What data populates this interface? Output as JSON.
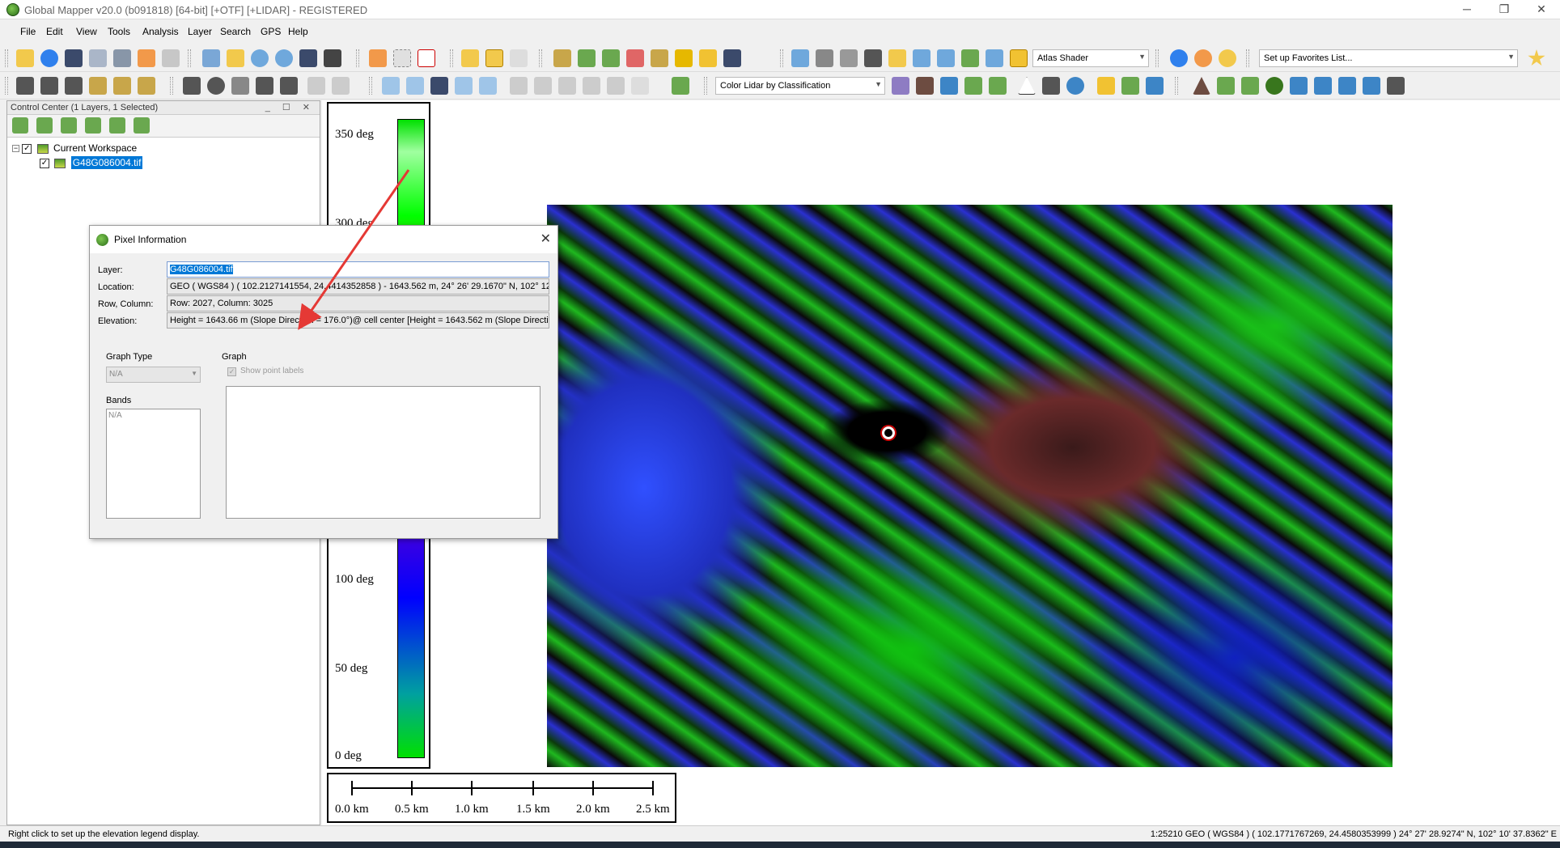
{
  "window": {
    "title": "Global Mapper v20.0 (b091818) [64-bit] [+OTF] [+LIDAR] - REGISTERED",
    "minimize": "─",
    "restore": "❐",
    "close": "✕"
  },
  "menu": [
    "File",
    "Edit",
    "View",
    "Tools",
    "Analysis",
    "Layer",
    "Search",
    "GPS",
    "Help"
  ],
  "toolbar": {
    "shader_select": "Atlas Shader",
    "favorites_select": "Set up Favorites List...",
    "lidar_select": "Color Lidar by Classification"
  },
  "control_center": {
    "title": "Control Center (1 Layers, 1 Selected)",
    "header_buttons": "_ ☐ ✕",
    "tree": {
      "workspace": "Current Workspace",
      "layer": "G48G086004.tif"
    }
  },
  "legend": {
    "ticks": [
      "350 deg",
      "300 deg",
      "100 deg",
      "50 deg",
      "0 deg"
    ]
  },
  "scale": {
    "labels": [
      "0.0 km",
      "0.5 km",
      "1.0 km",
      "1.5 km",
      "2.0 km",
      "2.5 km"
    ]
  },
  "dialog": {
    "title": "Pixel Information",
    "close": "✕",
    "labels": {
      "layer": "Layer:",
      "location": "Location:",
      "rowcol": "Row, Column:",
      "elevation": "Elevation:"
    },
    "values": {
      "layer": "G48G086004.tif",
      "location": "GEO ( WGS84 ) ( 102.2127141554, 24.4414352858 ) - 1643.562 m, 24° 26' 29.1670\" N, 102° 12'",
      "rowcol": "Row: 2027, Column: 3025",
      "elevation": "Height = 1643.66 m (Slope Direction = 176.0°)@ cell center [Height = 1643.562 m (Slope Directic"
    },
    "graph_type_label": "Graph Type",
    "graph_type_value": "N/A",
    "graph_label": "Graph",
    "show_point_labels": "Show point labels",
    "bands_label": "Bands",
    "bands_value": "N/A"
  },
  "status": {
    "left": "Right click to set up the elevation legend display.",
    "right": "1:25210  GEO ( WGS84 ) ( 102.1771767269, 24.4580353999 )  24° 27' 28.9274\" N, 102° 10' 37.8362\" E"
  },
  "colors": {
    "arrow": "#e53935",
    "selection": "#0078d7"
  }
}
